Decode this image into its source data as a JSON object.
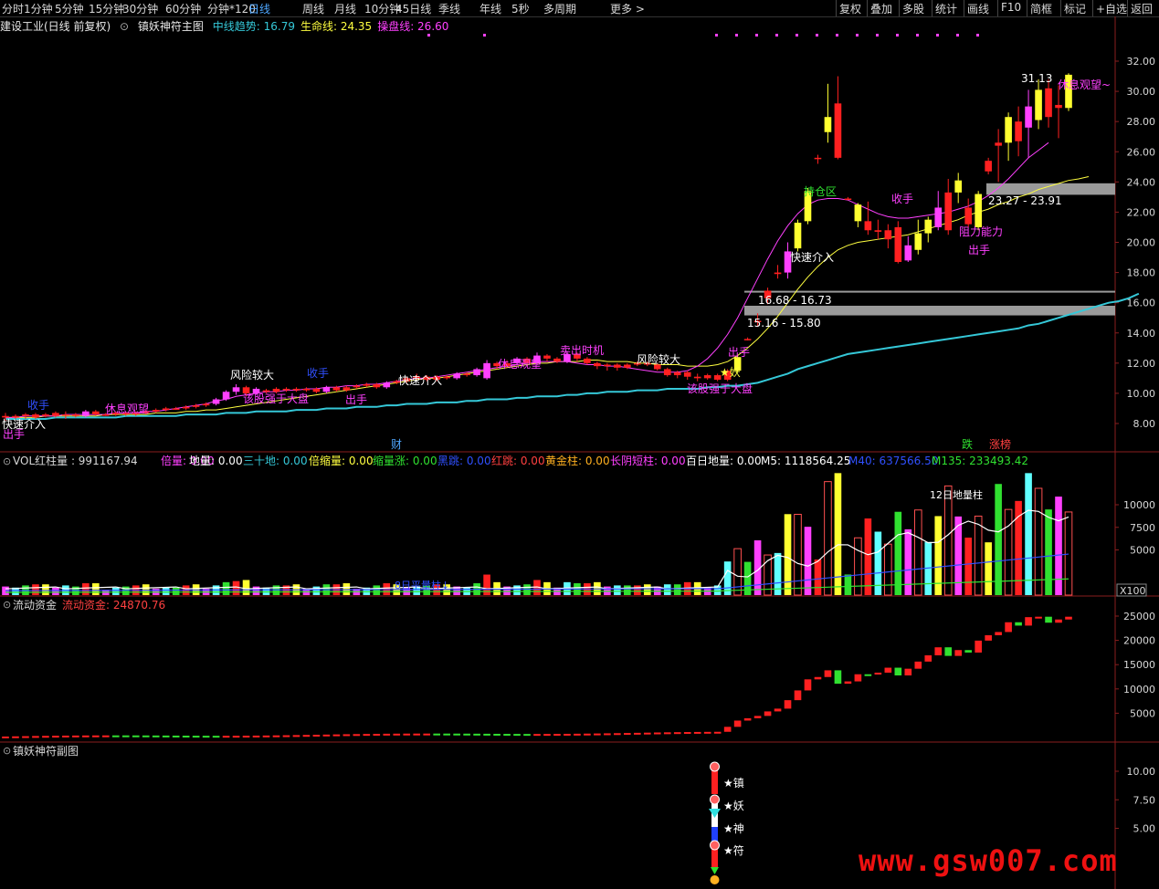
{
  "toolbar": {
    "left": [
      "分时",
      "1分钟",
      "5分钟",
      "15分钟",
      "30分钟",
      "60分钟",
      "分钟*120",
      "日线",
      "周线",
      "月线",
      "10分钟",
      "45日线",
      "季线",
      "年线",
      "5秒",
      "多周期",
      "更多 >"
    ],
    "active": "日线",
    "right": [
      "复权",
      "叠加",
      "多股",
      "统计",
      "画线",
      "F10",
      "简框",
      "标记",
      "+自选",
      "返回"
    ]
  },
  "main": {
    "stock": "建设工业(日线 前复权)",
    "indicator": "镇妖神符主图",
    "legend": [
      {
        "label": "中线趋势: 16.79",
        "color": "#35c8d8"
      },
      {
        "label": "生命线: 24.35",
        "color": "#ffff40"
      },
      {
        "label": "操盘线: 26.60",
        "color": "#ff40ff"
      }
    ],
    "y_ticks": [
      "32.00",
      "30.00",
      "28.00",
      "26.00",
      "24.00",
      "22.00",
      "20.00",
      "18.00",
      "16.00",
      "14.00",
      "12.00",
      "10.00",
      "8.00"
    ],
    "annotations": [
      {
        "text": "31.13",
        "color": "#ffffff"
      },
      {
        "text": "休息观望~",
        "color": "#ff40ff"
      },
      {
        "text": "23.27 - 23.91",
        "color": "#ffffff"
      },
      {
        "text": "16.68 - 16.73",
        "color": "#ffffff"
      },
      {
        "text": "15.16 - 15.80",
        "color": "#ffffff"
      },
      {
        "text": "持仓区",
        "color": "#30e030"
      },
      {
        "text": "快速介入",
        "color": "#ffffff"
      },
      {
        "text": "收手",
        "color": "#ff40ff"
      },
      {
        "text": "阻力能力",
        "color": "#ff40ff"
      },
      {
        "text": "出手",
        "color": "#ff40ff"
      },
      {
        "text": "★妖",
        "color": "#ffff40"
      },
      {
        "text": "出手",
        "color": "#ff40ff"
      },
      {
        "text": "风险较大",
        "color": "#ffffff"
      },
      {
        "text": "该股强于大盘",
        "color": "#ff40ff"
      },
      {
        "text": "卖出时机",
        "color": "#ff40ff"
      },
      {
        "text": "休息观望",
        "color": "#ff40ff"
      },
      {
        "text": "风险较大",
        "color": "#ffffff"
      },
      {
        "text": "收手",
        "color": "#3050ff"
      },
      {
        "text": "该股强于大盘",
        "color": "#ff40ff"
      },
      {
        "text": "出手",
        "color": "#ff40ff"
      },
      {
        "text": "快速介入",
        "color": "#ffffff"
      },
      {
        "text": "休息观望",
        "color": "#ff40ff"
      },
      {
        "text": "收手",
        "color": "#3050ff"
      },
      {
        "text": "快速介入",
        "color": "#ffffff"
      },
      {
        "text": "出手",
        "color": "#ff40ff"
      },
      {
        "text": "财",
        "color": "#4ea7ff"
      },
      {
        "text": "跌",
        "color": "#30e030"
      },
      {
        "text": "涨榜",
        "color": "#ff4040"
      }
    ]
  },
  "vol": {
    "legend": [
      {
        "label": "VOL红柱量 : 991167.94",
        "color": "#d8d8d8"
      },
      {
        "label": "倍量: 0.00",
        "color": "#ff40ff"
      },
      {
        "label": "地量: 0.00",
        "color": "#ffffff"
      },
      {
        "label": "三十地: 0.00",
        "color": "#35c8d8"
      },
      {
        "label": "倍缩量: 0.00",
        "color": "#ffff40"
      },
      {
        "label": "缩量涨: 0.00",
        "color": "#30e030"
      },
      {
        "label": "黑跳: 0.00",
        "color": "#3050ff"
      },
      {
        "label": "红跳: 0.00",
        "color": "#ff4040"
      },
      {
        "label": "黄金柱: 0.00",
        "color": "#ffb020"
      },
      {
        "label": "长阴短柱: 0.00",
        "color": "#ff40ff"
      },
      {
        "label": "百日地量: 0.00",
        "color": "#ffffff"
      },
      {
        "label": "M5: 1118564.25",
        "color": "#ffffff"
      },
      {
        "label": "M40: 637566.50",
        "color": "#3050ff"
      },
      {
        "label": "M135: 233493.42",
        "color": "#30e030"
      }
    ],
    "y_ticks": [
      "10000",
      "7500",
      "5000"
    ],
    "unit": "X100",
    "annotations": [
      "12日地量柱",
      "8日平量柱↓"
    ]
  },
  "flow": {
    "name": "流动资金",
    "label": "流动资金: 24870.76",
    "y_ticks": [
      "25000",
      "20000",
      "15000",
      "10000",
      "5000"
    ]
  },
  "sub": {
    "name": "镇妖神符副图",
    "y_ticks": [
      "10.00",
      "7.50",
      "5.00"
    ],
    "labels": [
      "★镇",
      "★妖",
      "★神",
      "★符"
    ]
  },
  "watermark": "www.gsw007.com",
  "chart_data": {
    "type": "candlestick",
    "ylim": [
      7,
      33
    ],
    "yticks": [
      32,
      30,
      28,
      26,
      24,
      22,
      20,
      18,
      16,
      14,
      12,
      10,
      8
    ],
    "candles": [
      {
        "o": 8.5,
        "c": 8.4,
        "h": 8.7,
        "l": 8.2
      },
      {
        "o": 8.5,
        "c": 8.4,
        "h": 8.6,
        "l": 8.3
      },
      {
        "o": 8.5,
        "c": 8.6,
        "h": 8.7,
        "l": 8.3
      },
      {
        "o": 8.6,
        "c": 8.4,
        "h": 8.7,
        "l": 8.3
      },
      {
        "o": 8.5,
        "c": 8.6,
        "h": 8.7,
        "l": 8.4
      },
      {
        "o": 8.7,
        "c": 8.5,
        "h": 8.8,
        "l": 8.4
      },
      {
        "o": 8.6,
        "c": 8.6,
        "h": 8.8,
        "l": 8.3
      },
      {
        "o": 8.6,
        "c": 8.5,
        "h": 8.7,
        "l": 8.4
      },
      {
        "o": 8.5,
        "c": 8.8,
        "h": 8.9,
        "l": 8.4
      },
      {
        "o": 8.8,
        "c": 8.6,
        "h": 8.9,
        "l": 8.5
      },
      {
        "o": 8.6,
        "c": 8.6,
        "h": 8.7,
        "l": 8.5
      },
      {
        "o": 8.6,
        "c": 8.7,
        "h": 8.8,
        "l": 8.5
      },
      {
        "o": 8.7,
        "c": 8.6,
        "h": 8.8,
        "l": 8.5
      },
      {
        "o": 8.6,
        "c": 8.7,
        "h": 8.8,
        "l": 8.5
      },
      {
        "o": 8.7,
        "c": 8.8,
        "h": 8.9,
        "l": 8.6
      },
      {
        "o": 8.8,
        "c": 8.9,
        "h": 9.0,
        "l": 8.7
      },
      {
        "o": 8.9,
        "c": 9.0,
        "h": 9.1,
        "l": 8.8
      },
      {
        "o": 9.0,
        "c": 9.0,
        "h": 9.1,
        "l": 8.9
      },
      {
        "o": 9.0,
        "c": 9.1,
        "h": 9.2,
        "l": 8.9
      },
      {
        "o": 9.1,
        "c": 9.2,
        "h": 9.3,
        "l": 9.0
      },
      {
        "o": 9.2,
        "c": 9.3,
        "h": 9.4,
        "l": 9.1
      },
      {
        "o": 9.3,
        "c": 9.6,
        "h": 9.7,
        "l": 9.2
      },
      {
        "o": 9.6,
        "c": 10.1,
        "h": 10.2,
        "l": 9.5
      },
      {
        "o": 10.1,
        "c": 10.4,
        "h": 10.6,
        "l": 9.9
      },
      {
        "o": 10.4,
        "c": 10.0,
        "h": 10.5,
        "l": 9.8
      },
      {
        "o": 10.0,
        "c": 10.3,
        "h": 10.4,
        "l": 9.9
      },
      {
        "o": 10.2,
        "c": 10.1,
        "h": 10.3,
        "l": 10.0
      },
      {
        "o": 10.1,
        "c": 10.3,
        "h": 10.4,
        "l": 10.0
      },
      {
        "o": 10.3,
        "c": 10.2,
        "h": 10.4,
        "l": 10.1
      },
      {
        "o": 10.3,
        "c": 10.2,
        "h": 10.4,
        "l": 10.1
      },
      {
        "o": 10.2,
        "c": 10.3,
        "h": 10.4,
        "l": 10.1
      },
      {
        "o": 10.3,
        "c": 10.1,
        "h": 10.4,
        "l": 10.0
      },
      {
        "o": 10.1,
        "c": 10.4,
        "h": 10.5,
        "l": 10.0
      },
      {
        "o": 10.4,
        "c": 10.2,
        "h": 10.5,
        "l": 10.1
      },
      {
        "o": 10.2,
        "c": 10.4,
        "h": 10.5,
        "l": 10.1
      },
      {
        "o": 10.4,
        "c": 10.5,
        "h": 10.6,
        "l": 10.3
      },
      {
        "o": 10.5,
        "c": 10.6,
        "h": 10.7,
        "l": 10.4
      },
      {
        "o": 10.6,
        "c": 10.4,
        "h": 10.7,
        "l": 10.3
      },
      {
        "o": 10.4,
        "c": 10.7,
        "h": 10.8,
        "l": 10.3
      },
      {
        "o": 10.7,
        "c": 10.8,
        "h": 10.9,
        "l": 10.6
      },
      {
        "o": 10.8,
        "c": 11.0,
        "h": 11.1,
        "l": 10.7
      },
      {
        "o": 11.0,
        "c": 11.1,
        "h": 11.3,
        "l": 10.9
      },
      {
        "o": 11.1,
        "c": 10.9,
        "h": 11.2,
        "l": 10.8
      },
      {
        "o": 10.9,
        "c": 11.1,
        "h": 11.2,
        "l": 10.8
      },
      {
        "o": 11.1,
        "c": 11.0,
        "h": 11.2,
        "l": 10.9
      },
      {
        "o": 11.0,
        "c": 11.3,
        "h": 11.4,
        "l": 10.9
      },
      {
        "o": 11.3,
        "c": 11.2,
        "h": 11.4,
        "l": 11.1
      },
      {
        "o": 11.2,
        "c": 11.6,
        "h": 11.7,
        "l": 11.1
      },
      {
        "o": 11.0,
        "c": 12.0,
        "h": 12.2,
        "l": 10.9
      },
      {
        "o": 12.0,
        "c": 11.8,
        "h": 12.1,
        "l": 11.6
      },
      {
        "o": 11.8,
        "c": 12.0,
        "h": 12.2,
        "l": 11.7
      },
      {
        "o": 12.0,
        "c": 12.3,
        "h": 12.4,
        "l": 11.9
      },
      {
        "o": 12.3,
        "c": 12.0,
        "h": 12.4,
        "l": 11.9
      },
      {
        "o": 12.0,
        "c": 12.5,
        "h": 12.7,
        "l": 11.9
      },
      {
        "o": 12.5,
        "c": 12.3,
        "h": 12.6,
        "l": 12.1
      },
      {
        "o": 12.3,
        "c": 12.1,
        "h": 12.4,
        "l": 12.0
      },
      {
        "o": 12.1,
        "c": 12.6,
        "h": 12.8,
        "l": 12.0
      },
      {
        "o": 12.6,
        "c": 12.3,
        "h": 12.7,
        "l": 12.1
      },
      {
        "o": 12.3,
        "c": 12.0,
        "h": 12.4,
        "l": 11.9
      },
      {
        "o": 12.0,
        "c": 11.8,
        "h": 12.1,
        "l": 11.6
      },
      {
        "o": 11.8,
        "c": 11.9,
        "h": 12.0,
        "l": 11.5
      },
      {
        "o": 11.9,
        "c": 11.7,
        "h": 12.0,
        "l": 11.5
      },
      {
        "o": 11.7,
        "c": 11.9,
        "h": 12.0,
        "l": 11.6
      },
      {
        "o": 11.9,
        "c": 12.0,
        "h": 12.1,
        "l": 11.8
      },
      {
        "o": 12.0,
        "c": 11.9,
        "h": 12.1,
        "l": 11.8
      },
      {
        "o": 11.9,
        "c": 11.6,
        "h": 12.0,
        "l": 11.5
      },
      {
        "o": 11.6,
        "c": 11.2,
        "h": 11.7,
        "l": 11.1
      },
      {
        "o": 11.2,
        "c": 11.4,
        "h": 11.5,
        "l": 11.0
      },
      {
        "o": 11.4,
        "c": 11.1,
        "h": 11.5,
        "l": 10.9
      },
      {
        "o": 11.1,
        "c": 11.0,
        "h": 11.3,
        "l": 10.8
      },
      {
        "o": 11.0,
        "c": 11.2,
        "h": 11.3,
        "l": 10.9
      },
      {
        "o": 11.2,
        "c": 10.9,
        "h": 11.3,
        "l": 10.8
      },
      {
        "o": 10.9,
        "c": 11.5,
        "h": 11.6,
        "l": 10.8
      },
      {
        "o": 11.5,
        "c": 12.4,
        "h": 12.5,
        "l": 11.4
      },
      {
        "o": 13.6,
        "c": 13.6,
        "h": 13.7,
        "l": 13.5
      },
      {
        "o": 14.8,
        "c": 14.8,
        "h": 15.3,
        "l": 14.4
      },
      {
        "o": 16.3,
        "c": 16.8,
        "h": 17.0,
        "l": 15.9
      },
      {
        "o": 17.9,
        "c": 18.0,
        "h": 18.5,
        "l": 17.6
      },
      {
        "o": 18.0,
        "c": 19.4,
        "h": 20.0,
        "l": 17.6
      },
      {
        "o": 19.6,
        "c": 21.3,
        "h": 21.5,
        "l": 19.4
      },
      {
        "o": 21.4,
        "c": 23.4,
        "h": 23.6,
        "l": 21.2
      },
      {
        "o": 25.6,
        "c": 25.6,
        "h": 25.8,
        "l": 25.2
      },
      {
        "o": 27.3,
        "c": 28.3,
        "h": 30.5,
        "l": 26.6
      },
      {
        "o": 29.2,
        "c": 25.6,
        "h": 31.0,
        "l": 25.5
      },
      {
        "o": 22.9,
        "c": 22.9,
        "h": 23.0,
        "l": 22.8
      },
      {
        "o": 21.4,
        "c": 22.5,
        "h": 22.6,
        "l": 21.0
      },
      {
        "o": 21.4,
        "c": 20.8,
        "h": 22.7,
        "l": 20.5
      },
      {
        "o": 20.8,
        "c": 20.7,
        "h": 21.5,
        "l": 20.2
      },
      {
        "o": 20.2,
        "c": 20.8,
        "h": 21.2,
        "l": 19.6
      },
      {
        "o": 21.0,
        "c": 18.7,
        "h": 21.4,
        "l": 18.6
      },
      {
        "o": 18.8,
        "c": 19.8,
        "h": 20.4,
        "l": 18.7
      },
      {
        "o": 19.5,
        "c": 20.6,
        "h": 21.5,
        "l": 19.2
      },
      {
        "o": 20.6,
        "c": 21.5,
        "h": 21.7,
        "l": 20.0
      },
      {
        "o": 21.0,
        "c": 22.3,
        "h": 23.4,
        "l": 20.8
      },
      {
        "o": 23.3,
        "c": 20.8,
        "h": 24.2,
        "l": 20.5
      },
      {
        "o": 23.3,
        "c": 24.1,
        "h": 24.6,
        "l": 22.6
      },
      {
        "o": 22.3,
        "c": 21.2,
        "h": 22.9,
        "l": 21.0
      },
      {
        "o": 21.0,
        "c": 23.2,
        "h": 23.4,
        "l": 20.8
      },
      {
        "o": 24.7,
        "c": 25.4,
        "h": 25.6,
        "l": 24.5
      },
      {
        "o": 26.4,
        "c": 26.6,
        "h": 27.5,
        "l": 24.0
      },
      {
        "o": 26.6,
        "c": 28.3,
        "h": 28.6,
        "l": 25.4
      },
      {
        "o": 28.0,
        "c": 26.7,
        "h": 29.0,
        "l": 25.7
      },
      {
        "o": 27.6,
        "c": 29.0,
        "h": 30.1,
        "l": 25.6
      },
      {
        "o": 28.1,
        "c": 30.1,
        "h": 30.8,
        "l": 27.5
      },
      {
        "o": 30.2,
        "c": 28.3,
        "h": 30.8,
        "l": 27.6
      },
      {
        "o": 28.9,
        "c": 29.1,
        "h": 30.4,
        "l": 26.9
      },
      {
        "o": 28.9,
        "c": 31.1,
        "h": 31.2,
        "l": 28.7
      }
    ],
    "ma_mid_trend": [
      8.3,
      8.3,
      8.3,
      8.3,
      8.3,
      8.4,
      8.4,
      8.4,
      8.4,
      8.4,
      8.4,
      8.4,
      8.5,
      8.5,
      8.5,
      8.5,
      8.5,
      8.5,
      8.6,
      8.6,
      8.6,
      8.6,
      8.7,
      8.7,
      8.7,
      8.8,
      8.8,
      8.8,
      8.8,
      8.9,
      8.9,
      8.9,
      9.0,
      9.0,
      9.0,
      9.1,
      9.1,
      9.1,
      9.2,
      9.2,
      9.3,
      9.3,
      9.3,
      9.4,
      9.4,
      9.4,
      9.5,
      9.5,
      9.6,
      9.6,
      9.6,
      9.7,
      9.7,
      9.8,
      9.8,
      9.8,
      9.9,
      9.9,
      10.0,
      10.0,
      10.1,
      10.1,
      10.1,
      10.2,
      10.2,
      10.2,
      10.3,
      10.3,
      10.3,
      10.3,
      10.4,
      10.4,
      10.5,
      10.5,
      10.6,
      10.7,
      10.9,
      11.1,
      11.3,
      11.6,
      11.8,
      12.0,
      12.2,
      12.4,
      12.6,
      12.7,
      12.8,
      12.9,
      13.0,
      13.1,
      13.2,
      13.3,
      13.4,
      13.5,
      13.6,
      13.7,
      13.8,
      13.9,
      14.0,
      14.1,
      14.2,
      14.3,
      14.5,
      14.6,
      14.8,
      15.0,
      15.2,
      15.4,
      15.6,
      15.8,
      16.0,
      16.1,
      16.3,
      16.6
    ],
    "ma_life": [
      8.4,
      8.4,
      8.4,
      8.4,
      8.5,
      8.5,
      8.5,
      8.5,
      8.5,
      8.5,
      8.6,
      8.6,
      8.6,
      8.6,
      8.6,
      8.7,
      8.7,
      8.7,
      8.8,
      8.8,
      8.9,
      8.9,
      9.0,
      9.1,
      9.2,
      9.3,
      9.4,
      9.5,
      9.6,
      9.7,
      9.8,
      9.9,
      10.0,
      10.1,
      10.2,
      10.3,
      10.4,
      10.5,
      10.6,
      10.7,
      10.8,
      10.9,
      11.0,
      11.0,
      11.1,
      11.2,
      11.3,
      11.4,
      11.5,
      11.6,
      11.7,
      11.8,
      11.9,
      12.0,
      12.0,
      12.1,
      12.1,
      12.1,
      12.2,
      12.2,
      12.1,
      12.1,
      12.1,
      12.0,
      12.0,
      11.9,
      11.9,
      11.9,
      11.8,
      11.8,
      11.8,
      11.9,
      12.1,
      12.5,
      13.0,
      13.6,
      14.3,
      15.1,
      16.0,
      16.9,
      17.7,
      18.4,
      19.0,
      19.5,
      19.8,
      20.0,
      20.1,
      20.2,
      20.3,
      20.4,
      20.5,
      20.7,
      20.9,
      21.1,
      21.3,
      21.5,
      21.8,
      22.0,
      22.2,
      22.5,
      22.7,
      23.0,
      23.2,
      23.5,
      23.7,
      23.9,
      24.1,
      24.2,
      24.35
    ],
    "ma_op": [
      8.4,
      8.4,
      8.5,
      8.5,
      8.5,
      8.5,
      8.6,
      8.6,
      8.6,
      8.6,
      8.6,
      8.7,
      8.7,
      8.7,
      8.8,
      8.8,
      8.9,
      9.0,
      9.1,
      9.2,
      9.3,
      9.5,
      9.6,
      9.8,
      9.9,
      10.0,
      10.1,
      10.1,
      10.2,
      10.2,
      10.3,
      10.3,
      10.4,
      10.4,
      10.5,
      10.5,
      10.6,
      10.6,
      10.7,
      10.8,
      10.9,
      11.0,
      11.0,
      11.1,
      11.2,
      11.3,
      11.4,
      11.5,
      11.6,
      11.7,
      11.8,
      11.9,
      12.0,
      12.1,
      12.1,
      12.1,
      12.1,
      12.0,
      11.9,
      11.9,
      11.8,
      11.8,
      11.7,
      11.6,
      11.5,
      11.4,
      11.4,
      11.4,
      11.5,
      11.8,
      12.3,
      13.0,
      13.9,
      15.0,
      16.3,
      17.6,
      18.9,
      20.1,
      21.1,
      21.9,
      22.5,
      22.8,
      22.9,
      22.9,
      22.8,
      22.5,
      22.2,
      21.9,
      21.7,
      21.6,
      21.6,
      21.7,
      21.8,
      21.9,
      22.0,
      22.2,
      22.4,
      22.7,
      23.1,
      23.6,
      24.2,
      24.9,
      25.6,
      26.1,
      26.6
    ]
  }
}
